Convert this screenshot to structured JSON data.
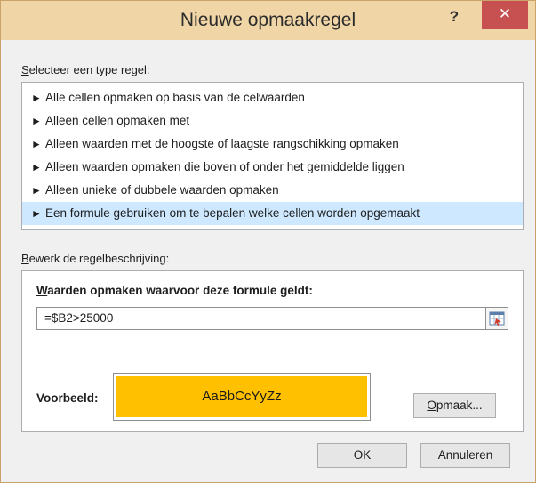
{
  "dialog": {
    "title": "Nieuwe opmaakregel",
    "help_label": "?",
    "close_label": "✕"
  },
  "rule_type": {
    "label_mnemonic": "S",
    "label_rest": "electeer een type regel:",
    "items": [
      {
        "label": "Alle cellen opmaken op basis van de celwaarden",
        "selected": false
      },
      {
        "label": "Alleen cellen opmaken met",
        "selected": false
      },
      {
        "label": "Alleen waarden met de hoogste of laagste rangschikking opmaken",
        "selected": false
      },
      {
        "label": "Alleen waarden opmaken die boven of onder het gemiddelde liggen",
        "selected": false
      },
      {
        "label": "Alleen unieke of dubbele waarden opmaken",
        "selected": false
      },
      {
        "label": "Een formule gebruiken om te bepalen welke cellen worden opgemaakt",
        "selected": true
      }
    ],
    "arrow_glyph": "►"
  },
  "description": {
    "label_mnemonic": "B",
    "label_rest": "ewerk de regelbeschrijving:",
    "formula_label_mnemonic": "W",
    "formula_label_rest": "aarden opmaken waarvoor deze formule geldt:",
    "formula_value": "=$B2>25000",
    "range_button_icon": "collapse-dialog-icon",
    "preview_label": "Voorbeeld:",
    "preview_text": "AaBbCcYyZz",
    "preview_fill_color": "#ffc000",
    "format_button_mnemonic": "O",
    "format_button_rest": "pmaak..."
  },
  "footer": {
    "ok_label": "OK",
    "cancel_label": "Annuleren"
  },
  "colors": {
    "titlebar": "#f0d6a6",
    "close_button": "#c75050",
    "selection": "#cde8ff"
  }
}
